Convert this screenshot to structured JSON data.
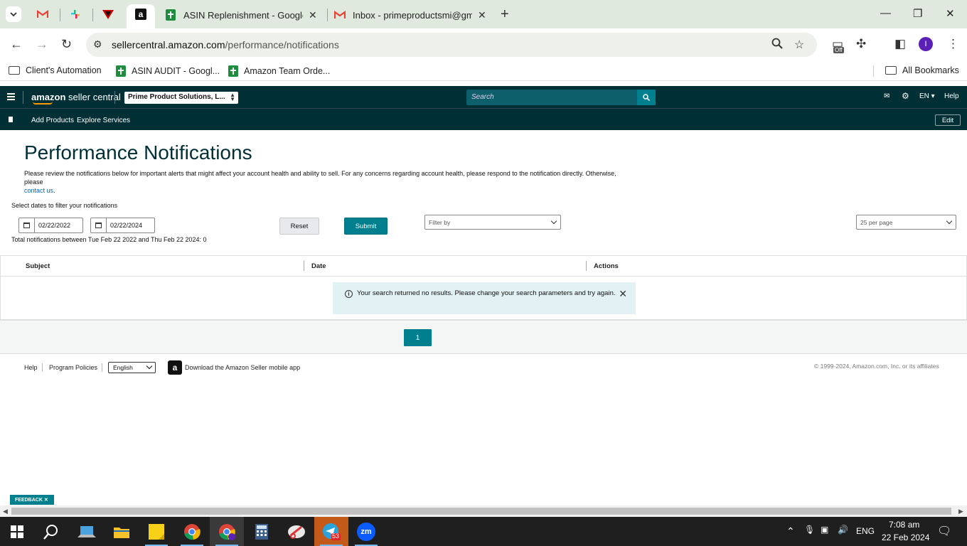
{
  "browser": {
    "tabs": [
      {
        "title": "ASIN Replenishment - Google Sheets"
      },
      {
        "title": "Inbox - primeproductsmi@gmail.com"
      }
    ],
    "url_host": "sellercentral.amazon.com",
    "url_path": "/performance/notifications",
    "extension_badge": "Off",
    "profile_initial": "I",
    "bookmarks": [
      {
        "label": "Client's Automation",
        "icon": "folder-icon"
      },
      {
        "label": "ASIN AUDIT - Googl...",
        "icon": "sheets-icon"
      },
      {
        "label": "Amazon Team Orde...",
        "icon": "sheets-icon"
      }
    ],
    "all_bookmarks": "All Bookmarks"
  },
  "seller_central": {
    "logo_brand": "amazon",
    "logo_product": "seller central",
    "account": "Prime Product Solutions, L...",
    "search_placeholder": "Search",
    "language": "EN",
    "help": "Help",
    "nav": [
      "Add Products",
      "Explore Services"
    ],
    "edit": "Edit"
  },
  "page": {
    "title": "Performance Notifications",
    "intro": "Please review the notifications below for important alerts that might affect your account health and ability to sell. For any concerns regarding account health, please respond to the notification directly. Otherwise, please",
    "intro_link": "contact us",
    "intro_end": ".",
    "filter_label": "Select dates to filter your notifications",
    "date_from": "02/22/2022",
    "date_to": "02/22/2024",
    "reset": "Reset",
    "submit": "Submit",
    "filter_by": "Filter by",
    "per_page": "25 per page",
    "total": "Total notifications between Tue Feb 22 2022 and Thu Feb 22 2024: 0",
    "columns": [
      "Subject",
      "Date",
      "Actions"
    ],
    "alert": "Your search returned no results. Please change your search parameters and try again.",
    "current_page": "1"
  },
  "footer": {
    "links": [
      "Help",
      "Program Policies"
    ],
    "language": "English",
    "app_text": "Download the Amazon Seller mobile app",
    "copyright": "© 1999-2024, Amazon.com, Inc. or its affiliates",
    "feedback": "FEEDBACK ✕"
  },
  "taskbar": {
    "language": "ENG",
    "time": "7:08 am",
    "date": "22 Feb 2024",
    "telegram_badge": "53"
  },
  "colors": {
    "sc_header": "#002f36",
    "teal": "#00808f",
    "chrome_strip": "#dfe9dd"
  }
}
